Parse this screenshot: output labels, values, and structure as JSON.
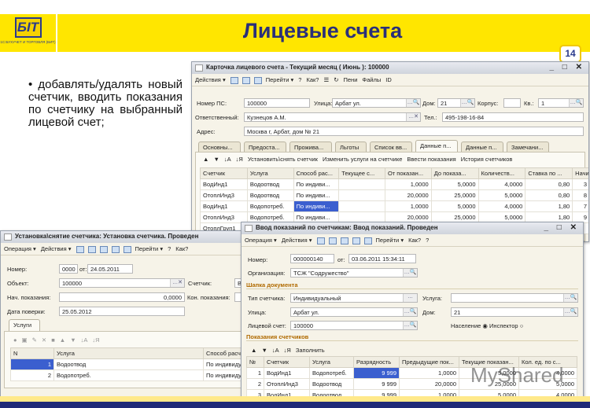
{
  "slide": {
    "title": "Лицевые счета",
    "page_number": "14",
    "logo_text": "БIT",
    "logo_caption": "1С:БУХУЧЕТ И ТОРГОВЛЯ (БИТ)",
    "bullet": "• добавлять/удалять новый счетчик, вводить показания по счетчику на выбранный лицевой счет;",
    "watermark": "MyShared"
  },
  "w1": {
    "title": "Карточка лицевого счета - Текущий месяц ( Июнь ): 100000",
    "toolbar": [
      "Действия ▾",
      "Перейти ▾",
      "Как?",
      "Пени",
      "Файлы",
      "ID"
    ],
    "fields": {
      "nomer_label": "Номер ПС:",
      "nomer": "100000",
      "ulica_label": "Улица:",
      "ulica": "Арбат ул.",
      "dom_label": "Дом:",
      "dom": "21",
      "korpus_label": "Корпус:",
      "korpus": "",
      "kv_label": "Кв.:",
      "kv": "1",
      "otv_label": "Ответственный:",
      "otv": "Кузнецов А.М.",
      "tel_label": "Тел.:",
      "tel": "495-198-16-84",
      "adres_label": "Адрес:",
      "adres": "Москва г, Арбат, дом № 21"
    },
    "tabs": [
      "Основны...",
      "Предоста...",
      "Прожива...",
      "Льготы",
      "Список вв...",
      "Данные п...",
      "Данные п...",
      "Замечани..."
    ],
    "subtoolbar": [
      "Установить\\снять счетчик",
      "Изменить услуги на счетчике",
      "Ввести показания",
      "История счетчиков"
    ],
    "columns": [
      "Счетчик",
      "Услуга",
      "Способ рас...",
      "Текущее с...",
      "От показан...",
      "До показа...",
      "Количеств...",
      "Ставка по ...",
      "Начислен"
    ],
    "rows": [
      [
        "ВодИнд1",
        "Водоотвод",
        "По индиви...",
        "",
        "1,0000",
        "5,0000",
        "4,0000",
        "0,80",
        "3"
      ],
      [
        "ОтоплИнд3",
        "Водоотвод",
        "По индиви...",
        "",
        "20,0000",
        "25,0000",
        "5,0000",
        "0,80",
        "8"
      ],
      [
        "ВодИнд1",
        "Водопотреб.",
        "По индиви...",
        "",
        "1,0000",
        "5,0000",
        "4,0000",
        "1,80",
        "7"
      ],
      [
        "ОтоплИнд3",
        "Водопотреб.",
        "По индиви...",
        "",
        "20,0000",
        "25,0000",
        "5,0000",
        "1,80",
        "9"
      ],
      [
        "ОтоплГруп1",
        "",
        "",
        "",
        "",
        "",
        "",
        "",
        ""
      ]
    ]
  },
  "w2": {
    "title": "Установка\\снятие счетчика: Установка счетчика. Проведен",
    "toolbar": [
      "Операция ▾",
      "Действия ▾",
      "Перейти ▾",
      "Как?"
    ],
    "fields": {
      "nomer_label": "Номер:",
      "nomer": "0000",
      "ot_label": "от:",
      "date": "24.05.2011",
      "obj_label": "Объект:",
      "obj": "100000",
      "sch_label": "Счетчик:",
      "sch": "В",
      "nach_label": "Нач. показания:",
      "nach": "0,0000",
      "kon_label": "Кон. показания:",
      "poverka_label": "Дата поверки:",
      "poverka": "25.05.2012"
    },
    "tab": "Услуги",
    "columns": [
      "N",
      "Услуга",
      "Способ расче"
    ],
    "rows": [
      [
        "1",
        "Водоотвод",
        "По индивиду"
      ],
      [
        "2",
        "Водопотреб.",
        "По индивиду"
      ]
    ]
  },
  "w3": {
    "title": "Ввод показаний по счетчикам: Ввод показаний. Проведен",
    "toolbar": [
      "Операция ▾",
      "Действия ▾",
      "Перейти ▾",
      "Как?"
    ],
    "fields": {
      "nomer_label": "Номер:",
      "nomer": "000000140",
      "ot_label": "от:",
      "date": "03.06.2011 15:34:11",
      "org_label": "Организация:",
      "org": "ТСЖ \"Содружество\"",
      "sect1": "Шапка документа",
      "tip_label": "Тип счетчика:",
      "tip": "Индивидуальный",
      "usluga_label": "Услуга:",
      "usluga": "",
      "ulica_label": "Улица:",
      "ulica": "Арбат ул.",
      "dom_label": "Дом:",
      "dom": "21",
      "ls_label": "Лицевой счет:",
      "ls": "100000",
      "naselenie": "Население",
      "inspektor": "Инспектор",
      "sect2": "Показания счетчиков",
      "fill": "Заполнить"
    },
    "columns": [
      "№",
      "Счетчик",
      "Услуга",
      "Разрядность",
      "Предыдущие пок...",
      "Текущие показан...",
      "Кол. ед. по с..."
    ],
    "rows": [
      [
        "1",
        "ВодИнд1",
        "Водопотреб.",
        "9 999",
        "1,0000",
        "5,0000",
        "4,0000"
      ],
      [
        "2",
        "ОтоплИнд3",
        "Водоотвод",
        "9 999",
        "20,0000",
        "25,0000",
        "5,0000"
      ],
      [
        "3",
        "ВодИнд1",
        "Водоотвод",
        "9 999",
        "1,0000",
        "5,0000",
        "4,0000"
      ]
    ]
  },
  "colors": {
    "band": "#ffe600",
    "title": "#2a2f7a",
    "bottom": "#202a78",
    "selection": "#3b5fcf"
  }
}
